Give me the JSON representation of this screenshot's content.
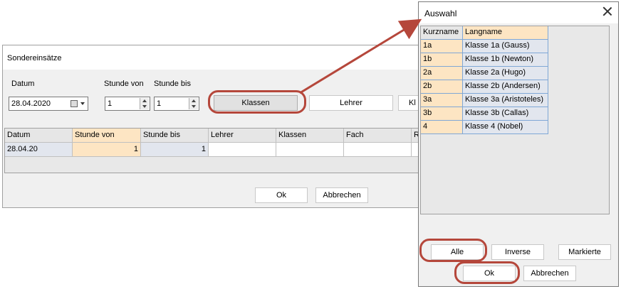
{
  "main_window": {
    "title": "Sondereinsätze",
    "labels": {
      "datum": "Datum",
      "stunde_von": "Stunde von",
      "stunde_bis": "Stunde bis"
    },
    "date_value": "28.04.2020",
    "stunde_von_value": "1",
    "stunde_bis_value": "1",
    "buttons": {
      "klassen": "Klassen",
      "lehrer": "Lehrer",
      "cut": "Kl"
    },
    "grid": {
      "headers": [
        "Datum",
        "Stunde von",
        "Stunde bis",
        "Lehrer",
        "Klassen",
        "Fach",
        "R"
      ],
      "row": [
        "28.04.20",
        "1",
        "1",
        "",
        "",
        "",
        ""
      ]
    },
    "ok_label": "Ok",
    "cancel_label": "Abbrechen"
  },
  "dialog": {
    "title": "Auswahl",
    "headers": {
      "short": "Kurzname",
      "long": "Langname"
    },
    "items": [
      {
        "short": "1a",
        "long": "Klasse 1a (Gauss)"
      },
      {
        "short": "1b",
        "long": "Klasse 1b (Newton)"
      },
      {
        "short": "2a",
        "long": "Klasse 2a (Hugo)"
      },
      {
        "short": "2b",
        "long": "Klasse 2b (Andersen)"
      },
      {
        "short": "3a",
        "long": "Klasse 3a (Aristoteles)"
      },
      {
        "short": "3b",
        "long": "Klasse 3b (Callas)"
      },
      {
        "short": "4",
        "long": "Klasse 4 (Nobel)"
      }
    ],
    "buttons": {
      "alle": "Alle",
      "inverse": "Inverse",
      "markierte": "Markierte",
      "ok": "Ok",
      "cancel": "Abbrechen"
    }
  },
  "colors": {
    "annotation": "#b5473b",
    "header_selected": "#fde5c3",
    "cell_blue": "#e2e6ee"
  },
  "icons": [
    "calendar-icon",
    "dropdown-arrow-icon",
    "spin-up-icon",
    "spin-down-icon",
    "close-icon"
  ]
}
